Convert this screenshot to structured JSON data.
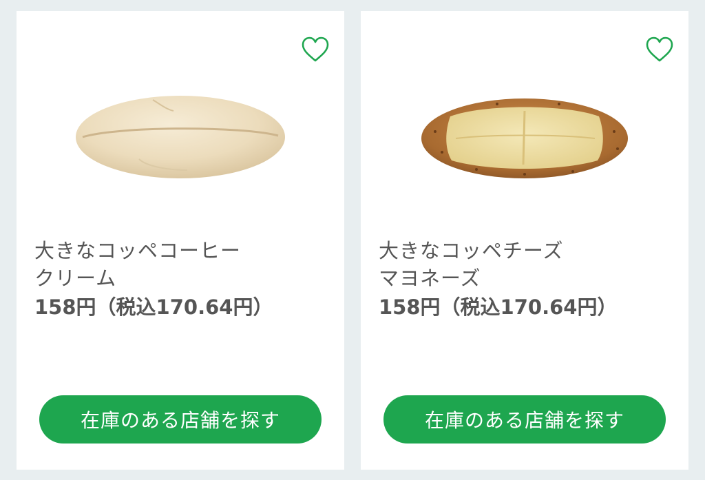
{
  "products": [
    {
      "name": "大きなコッペコーヒー\nクリーム",
      "price": "158円",
      "price_tax": "（税込170.64円）",
      "button_label": "在庫のある店舗を探す",
      "image": "plain-coppe-bread-icon",
      "favorite_icon": "heart-outline-icon"
    },
    {
      "name": "大きなコッペチーズ\nマヨネーズ",
      "price": "158円",
      "price_tax": "（税込170.64円）",
      "button_label": "在庫のある店舗を探す",
      "image": "cheese-mayo-bread-icon",
      "favorite_icon": "heart-outline-icon"
    }
  ],
  "colors": {
    "accent_green": "#1ea64f",
    "background": "#e8eef0",
    "card": "#ffffff",
    "text": "#555555"
  }
}
